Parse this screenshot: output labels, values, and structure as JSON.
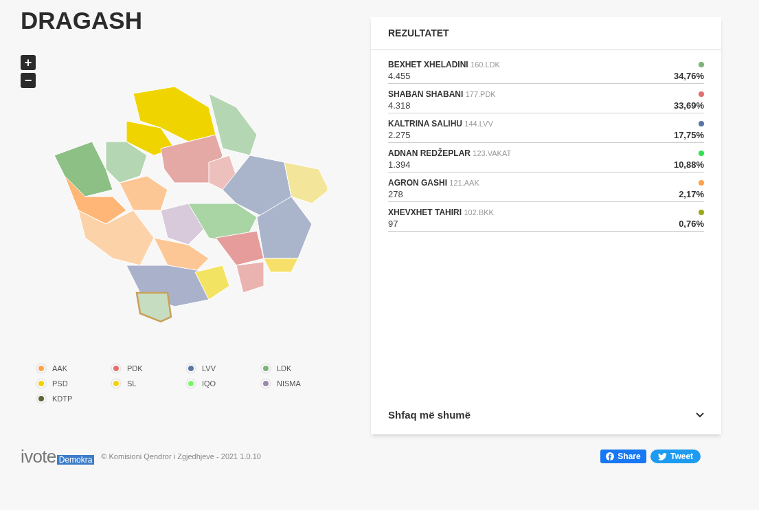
{
  "title": "DRAGASH",
  "zoom_controls": [
    "+",
    "−"
  ],
  "results": {
    "heading": "REZULTATET",
    "candidates": [
      {
        "name": "BEXHET XHELADINI",
        "code": "160.LDK",
        "votes": "4.455",
        "percent": "34,76%",
        "color": "#7fb27a"
      },
      {
        "name": "SHABAN SHABANI",
        "code": "177.PDK",
        "votes": "4.318",
        "percent": "33,69%",
        "color": "#e07070"
      },
      {
        "name": "KALTRINA SALIHU",
        "code": "144.LVV",
        "votes": "2.275",
        "percent": "17,75%",
        "color": "#5b76a3"
      },
      {
        "name": "ADNAN REDŽEPLAR",
        "code": "123.VAKAT",
        "votes": "1.394",
        "percent": "10,88%",
        "color": "#33e051"
      },
      {
        "name": "AGRON GASHI",
        "code": "121.AAK",
        "votes": "278",
        "percent": "2,17%",
        "color": "#ffa24d"
      },
      {
        "name": "XHEVXHET TAHIRI",
        "code": "102.BKK",
        "votes": "97",
        "percent": "0,76%",
        "color": "#9aa81a"
      }
    ],
    "show_more": "Shfaq më shumë"
  },
  "legend": [
    {
      "label": "AAK",
      "color": "#ffa24d"
    },
    {
      "label": "PDK",
      "color": "#e07070"
    },
    {
      "label": "LVV",
      "color": "#5b76a3"
    },
    {
      "label": "LDK",
      "color": "#7fb27a"
    },
    {
      "label": "PSD",
      "color": "#f0d000"
    },
    {
      "label": "SL",
      "color": "#f5d10c"
    },
    {
      "label": "IQO",
      "color": "#7cf56a"
    },
    {
      "label": "NISMA",
      "color": "#9c88a8"
    },
    {
      "label": "KDTP",
      "color": "#5e6436"
    }
  ],
  "footer": {
    "logo_text": "ivote",
    "logo_badge": "Demokra",
    "copyright": "© Komisioni Qendror i Zgjedhjeve - 2021 1.0.10"
  },
  "share_buttons": [
    {
      "kind": "facebook",
      "label": "Share"
    },
    {
      "kind": "twitter",
      "label": "Tweet"
    }
  ]
}
